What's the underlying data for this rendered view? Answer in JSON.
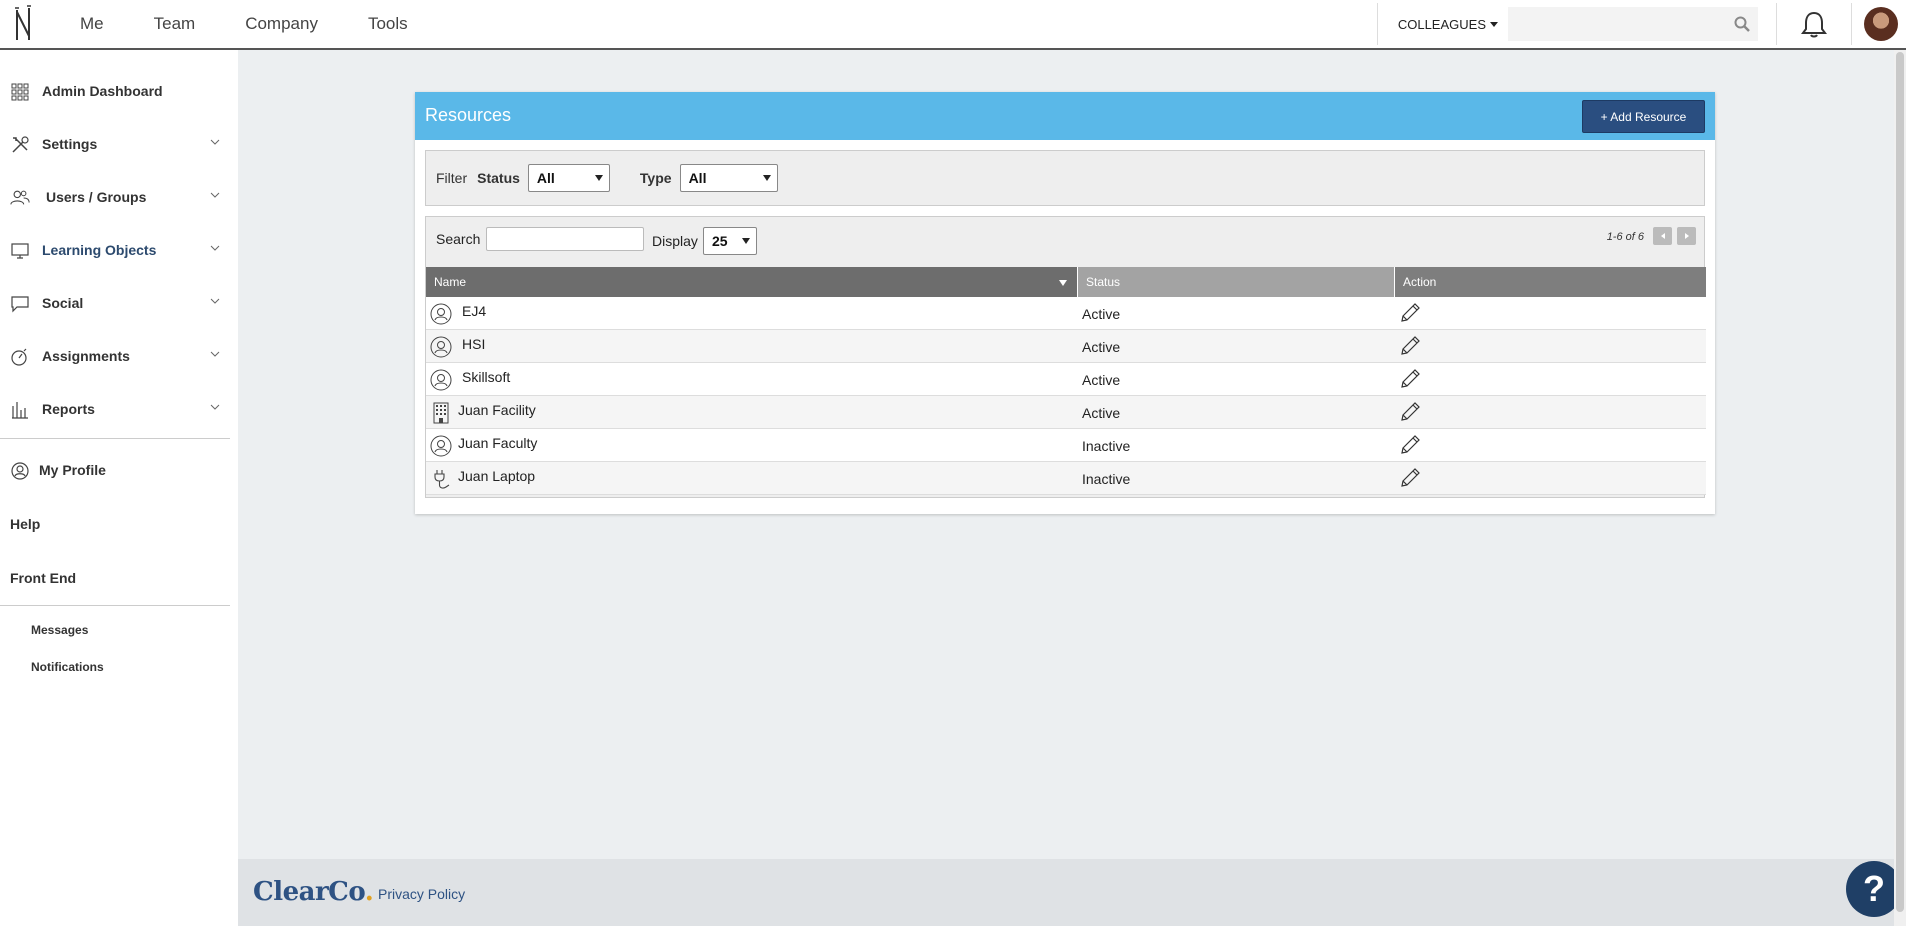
{
  "topbar": {
    "nav": [
      "Me",
      "Team",
      "Company",
      "Tools"
    ],
    "colleagues_label": "COLLEAGUES",
    "search_placeholder": ""
  },
  "sidebar": {
    "items": [
      {
        "label": "Admin Dashboard",
        "icon": "grid-icon"
      },
      {
        "label": "Settings",
        "icon": "tools-icon"
      },
      {
        "label": "Users / Groups",
        "icon": "users-icon"
      },
      {
        "label": "Learning Objects",
        "icon": "monitor-icon"
      },
      {
        "label": "Social",
        "icon": "chat-icon"
      },
      {
        "label": "Assignments",
        "icon": "stopwatch-icon"
      },
      {
        "label": "Reports",
        "icon": "bar-chart-icon"
      }
    ],
    "profile_label": "My Profile",
    "help_label": "Help",
    "frontend_label": "Front End",
    "messages_label": "Messages",
    "notifications_label": "Notifications"
  },
  "panel": {
    "title": "Resources",
    "add_button": "+ Add Resource",
    "filter": {
      "label": "Filter",
      "status_label": "Status",
      "status_value": "All",
      "type_label": "Type",
      "type_value": "All"
    },
    "search_label": "Search",
    "display_label": "Display",
    "display_value": "25",
    "pager_text": "1-6 of 6",
    "columns": [
      "Name",
      "Status",
      "Action"
    ],
    "rows": [
      {
        "name": "EJ4",
        "status": "Active",
        "icon": "person-icon"
      },
      {
        "name": "HSI",
        "status": "Active",
        "icon": "person-icon"
      },
      {
        "name": "Skillsoft",
        "status": "Active",
        "icon": "person-icon"
      },
      {
        "name": "Juan Facility",
        "status": "Active",
        "icon": "building-icon"
      },
      {
        "name": "Juan Faculty",
        "status": "Inactive",
        "icon": "person-icon"
      },
      {
        "name": "Juan Laptop",
        "status": "Inactive",
        "icon": "plug-icon"
      }
    ]
  },
  "footer": {
    "brand": "ClearCo",
    "brand_dot": ".",
    "privacy": "Privacy Policy",
    "help_symbol": "?"
  },
  "colors": {
    "header_blue": "#5ab8e8",
    "button_navy": "#2a4e80",
    "brand_blue": "#2e5283"
  }
}
